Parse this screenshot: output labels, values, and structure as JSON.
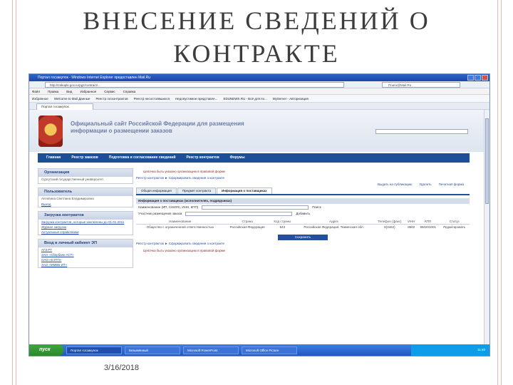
{
  "slide": {
    "title_line1": "ВНЕСЕНИЕ СВЕДЕНИЙ О",
    "title_line2": "КОНТРАКТЕ",
    "date": "3/16/2018"
  },
  "browser": {
    "window_title": "Портал госзакупок - Windows Internet Explorer предоставлен Mail.Ru",
    "address": "http://zakupki.gov.ru/pgz/contract/...",
    "search_placeholder": "Поиск@Mail.Ru",
    "menu": [
      "Файл",
      "Правка",
      "Вид",
      "Избранное",
      "Сервис",
      "Справка"
    ],
    "favorites": [
      "Избранное",
      "Welcome to Mail Данные",
      "Реестр госконтрактов",
      "Реестр несостоявшихся",
      "Недопустимое представле...",
      "EDUNEWS.RU - Всё для по...",
      "MyServer - Авторизация"
    ],
    "tab": "Портал госзакупок"
  },
  "site": {
    "title": "Официальный сайт Российской Федерации для размещения информации о размещении заказов",
    "nav": [
      "Главная",
      "Реестр заказов",
      "Подготовка и согласование сведений",
      "Реестр контрактов",
      "Форумы"
    ]
  },
  "left": {
    "org_header": "Организация",
    "org_text": "Сургутский государственный университет",
    "pers_header": "Пользователь",
    "pers_text": "Антипина Светлана Владимировна",
    "logout": "Выход",
    "upload_header": "Загрузка контрактов",
    "upload_links": [
      "Загрузка контрактов, которые заключены до 01.01.2011",
      "Журнал загрузок",
      "Актуальные справочники"
    ],
    "cabinet_header": "Вход в личный кабинет ЭП",
    "cabinet_links": [
      "АГЗ РТ",
      "ЗАО «Сбербанк-АСТ»",
      "ОАО «ЕЭТП»",
      "ЗАО «ММВБ-ИТ»"
    ]
  },
  "main": {
    "red_note": "Цепочка быть указано организацию в правовой форме",
    "breadcrumb_a": "Реестр контрактов",
    "breadcrumb_b": "Сформировать сведения о контракте",
    "tabs": [
      "Общая информация",
      "Предмет контракта",
      "Информация о поставщиках"
    ],
    "actions": [
      "Выдать на публикацию",
      "Удалить",
      "Печатная форма"
    ],
    "section": "Информация о поставщиках (исполнителях, подрядчиках)",
    "field1": "Наименование (ИП, СНИЛС, ИНН, КПП)",
    "field2": "Участник размещения заказа",
    "search_btn": "Поиск",
    "add_btn": "Добавить",
    "columns": [
      "Наименование",
      "Страна",
      "Код страны",
      "Адрес",
      "Телефон (факс)",
      "ИНН",
      "КПП",
      "Статус"
    ],
    "row": [
      "Общество с ограниченной ответственностью",
      "Российская Федерация",
      "643",
      "Российская Федерация, Тюменская обл.",
      "8(3462)",
      "8602",
      "860201001",
      "Редактировать"
    ],
    "save": "Сохранить",
    "breadcrumb2_a": "Реестр контрактов",
    "breadcrumb2_b": "Сформировать сведения о контракте"
  },
  "taskbar": {
    "start": "пуск",
    "tasks": [
      "Портал госзакупок",
      "Безымянный",
      "Microsoft PowerPoint",
      "Microsoft Office Picture"
    ],
    "clock": "11:40"
  }
}
